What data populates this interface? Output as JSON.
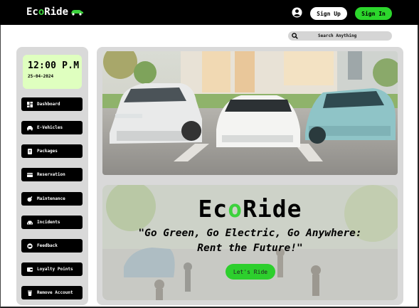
{
  "header": {
    "logo_prefix": "Ec",
    "logo_o": "o",
    "logo_suffix": "Ride",
    "signup_label": "Sign Up",
    "signin_label": "Sign In"
  },
  "search": {
    "placeholder": "Search Anything"
  },
  "clock": {
    "time": "12:00 P.M",
    "date": "25-04-2024"
  },
  "sidebar": {
    "items": [
      {
        "label": "Dashboard",
        "icon": "dashboard-icon"
      },
      {
        "label": "E-Vehicles",
        "icon": "car-icon"
      },
      {
        "label": "Packages",
        "icon": "package-icon"
      },
      {
        "label": "Reservation",
        "icon": "reservation-icon"
      },
      {
        "label": "Maintenance",
        "icon": "maintenance-icon"
      },
      {
        "label": "Incidents",
        "icon": "incident-car-icon"
      },
      {
        "label": "Feedback",
        "icon": "feedback-icon"
      },
      {
        "label": "Loyalty Points",
        "icon": "wallet-icon"
      },
      {
        "label": "Remove Account",
        "icon": "trash-icon"
      }
    ]
  },
  "promo": {
    "title_prefix": "Ec",
    "title_o": "o",
    "title_suffix": "Ride",
    "quote_line1": "\"Go Green, Go Electric, Go Anywhere:",
    "quote_line2": "Rent the Future!\"",
    "cta_label": "Let's Ride"
  },
  "colors": {
    "accent_green": "#2cd62c",
    "clock_bg": "#dfffbf",
    "panel_gray": "#d9d9d9",
    "topbar": "#000000"
  }
}
